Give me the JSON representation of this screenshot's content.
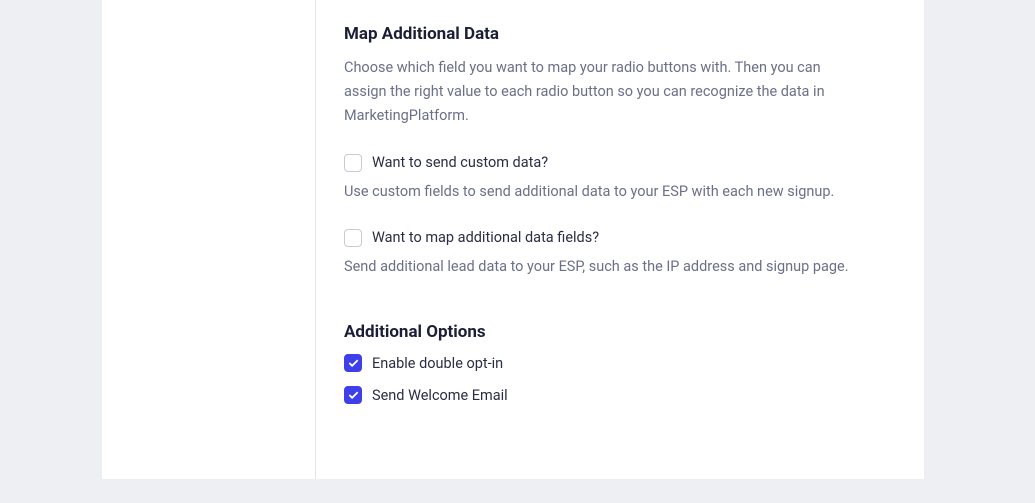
{
  "mapAdditionalData": {
    "heading": "Map Additional Data",
    "description": "Choose which field you want to map your radio buttons with. Then you can assign the right value to each radio button so you can recognize the data in MarketingPlatform.",
    "customData": {
      "label": "Want to send custom data?",
      "help": "Use custom fields to send additional data to your ESP with each new signup.",
      "checked": false
    },
    "mapFields": {
      "label": "Want to map additional data fields?",
      "help": "Send additional lead data to your ESP, such as the IP address and signup page.",
      "checked": false
    }
  },
  "additionalOptions": {
    "heading": "Additional Options",
    "doubleOptIn": {
      "label": "Enable double opt-in",
      "checked": true
    },
    "welcomeEmail": {
      "label": "Send Welcome Email",
      "checked": true
    }
  }
}
